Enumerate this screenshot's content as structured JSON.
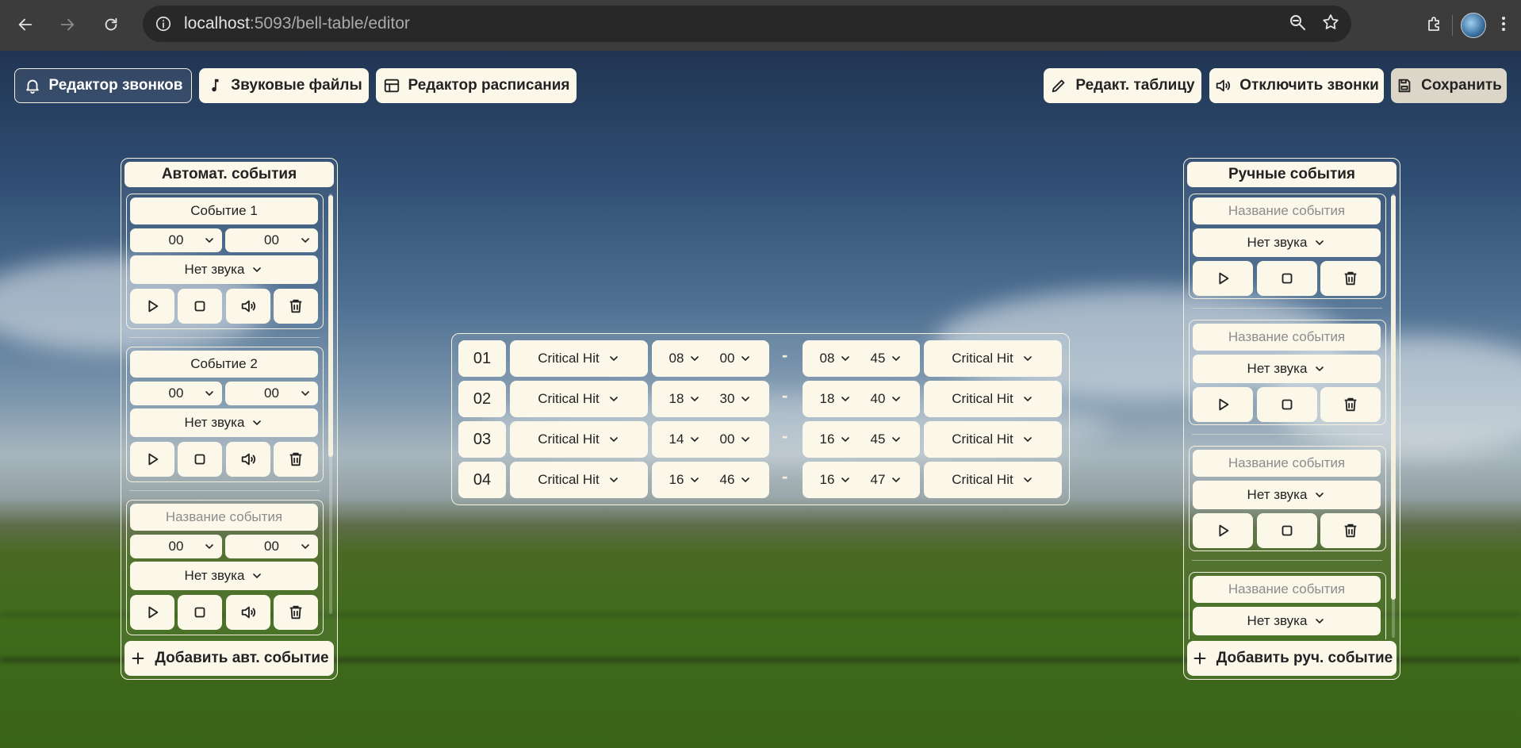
{
  "browser": {
    "url_host": "localhost",
    "url_path": ":5093/bell-table/editor"
  },
  "toolbar": {
    "bell_editor": "Редактор звонков",
    "sound_files": "Звуковые файлы",
    "schedule_editor": "Редактор расписания",
    "edit_table": "Редакт. таблицу",
    "disable_bells": "Отключить звонки",
    "save": "Сохранить"
  },
  "auto_panel": {
    "title": "Автомат. события",
    "events": [
      {
        "name": "Событие 1",
        "hour": "00",
        "minute": "00",
        "sound": "Нет звука"
      },
      {
        "name": "Событие 2",
        "hour": "00",
        "minute": "00",
        "sound": "Нет звука"
      },
      {
        "name": "",
        "name_placeholder": "Название события",
        "hour": "00",
        "minute": "00",
        "sound": "Нет звука"
      }
    ],
    "add_button": "Добавить авт. событие"
  },
  "manual_panel": {
    "title": "Ручные события",
    "events": [
      {
        "name_placeholder": "Название события",
        "sound": "Нет звука"
      },
      {
        "name_placeholder": "Название события",
        "sound": "Нет звука"
      },
      {
        "name_placeholder": "Название события",
        "sound": "Нет звука"
      },
      {
        "name_placeholder": "Название события",
        "sound": "Нет звука"
      }
    ],
    "add_button": "Добавить руч. событие"
  },
  "schedule": {
    "separator": "-",
    "rows": [
      {
        "num": "01",
        "start_sound": "Critical Hit",
        "start_h": "08",
        "start_m": "00",
        "end_h": "08",
        "end_m": "45",
        "end_sound": "Critical Hit"
      },
      {
        "num": "02",
        "start_sound": "Critical Hit",
        "start_h": "18",
        "start_m": "30",
        "end_h": "18",
        "end_m": "40",
        "end_sound": "Critical Hit"
      },
      {
        "num": "03",
        "start_sound": "Critical Hit",
        "start_h": "14",
        "start_m": "00",
        "end_h": "16",
        "end_m": "45",
        "end_sound": "Critical Hit"
      },
      {
        "num": "04",
        "start_sound": "Critical Hit",
        "start_h": "16",
        "start_m": "46",
        "end_h": "16",
        "end_m": "47",
        "end_sound": "Critical Hit"
      }
    ]
  }
}
